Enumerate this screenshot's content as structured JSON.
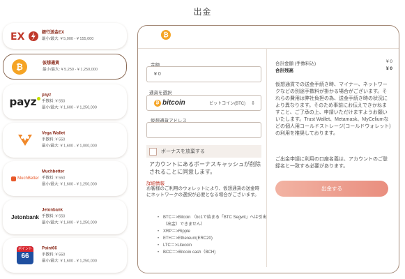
{
  "page": {
    "title": "出金"
  },
  "methods": [
    {
      "name": "銀行送金EX",
      "lines": [
        "最小/最大: ¥ 5,000 - ¥ 155,000"
      ],
      "logo": "bank-ex-logo"
    },
    {
      "name": "仮想通貨",
      "lines": [
        "最小/最大: ¥ 5,250 - ¥ 1,250,000"
      ],
      "logo": "bitcoin-icon",
      "selected": true
    },
    {
      "name": "payz",
      "lines": [
        "手数料: ¥ 550",
        "最小/最大: ¥ 1,600 - ¥ 1,250,000"
      ],
      "logo": "payz-logo"
    },
    {
      "name": "Vega Wallet",
      "lines": [
        "手数料: ¥ 550",
        "最小/最大: ¥ 1,600 - ¥ 1,000,000"
      ],
      "logo": "vega-wallet-logo"
    },
    {
      "name": "Muchbetter",
      "lines": [
        "手数料: ¥ 550",
        "最小/最大: ¥ 1,600 - ¥ 1,250,000"
      ],
      "logo": "muchbetter-logo"
    },
    {
      "name": "Jetonbank",
      "lines": [
        "手数料: ¥ 550",
        "最小/最大: ¥ 1,600 - ¥ 1,250,000"
      ],
      "logo": "jetonbank-logo"
    },
    {
      "name": "Point66",
      "lines": [
        "手数料: ¥ 550",
        "最小/最大: ¥ 1,600 - ¥ 1,250,000"
      ],
      "logo": "point66-logo"
    }
  ],
  "logos": {
    "payz": "payz",
    "jetonbank": "Jetonbank",
    "muchbetter": "MuchBetter",
    "point66_top": "ポイント",
    "point66_num": "66"
  },
  "form": {
    "amount_label": "金額",
    "amount_value": "¥ 0",
    "currency_label": "通貨を選択",
    "currency_logo": "bitcoin",
    "currency_value": "ビットコイン(BTC)",
    "address_label": "仮想通貨アドレス",
    "address_value": "",
    "bonus_label": "ボーナスを放棄する",
    "bonus_note": "アカウントにあるボーナスキャッシュが削除されることに同意します。",
    "details_link": "詳細情報",
    "details_text": "お客様のご利用のウォレットにより、仮想通貨の送金時にネットワークの選択が必要となる場合がございます。",
    "assets": [
      "BTC＝>Bitcoin （bc1で始まる「BTC Segwit」へは引出（出金）できません）",
      "XRP＝>Ripple",
      "ETH＝>Ethereum(ERC20)",
      "LTC＝>Litecoin",
      "BCC＝>Bitcoin cash（BCH)"
    ]
  },
  "summary": {
    "total_label": "合計金額 (手数料込)",
    "total_value": "¥ 0",
    "receive_label": "合計残高",
    "receive_value": "¥ 0",
    "notes": "仮想通貨での送金手続き時、マイナー、ネットワークなどの別途手数料が掛かる場合がございます。それらの費用は弊社負担の為、送金手続き時の状況により異なります。そのため事前にお伝えできかねますこと、ご了承の上、申請いただけますようお願いいたします。Trust Wallet、Metamask、MyCeliumなどの個人用コールドストレージ(コールドウォレット)の利用を推奨しております。",
    "notes2": "ご出金申請に利用の口座名義は、アカウントのご登録名と一致する必要があります。",
    "withdraw_button": "出金する"
  },
  "colors": {
    "accent": "#e98e7f",
    "bitcoin": "#f5a425",
    "border": "#a48a78"
  }
}
